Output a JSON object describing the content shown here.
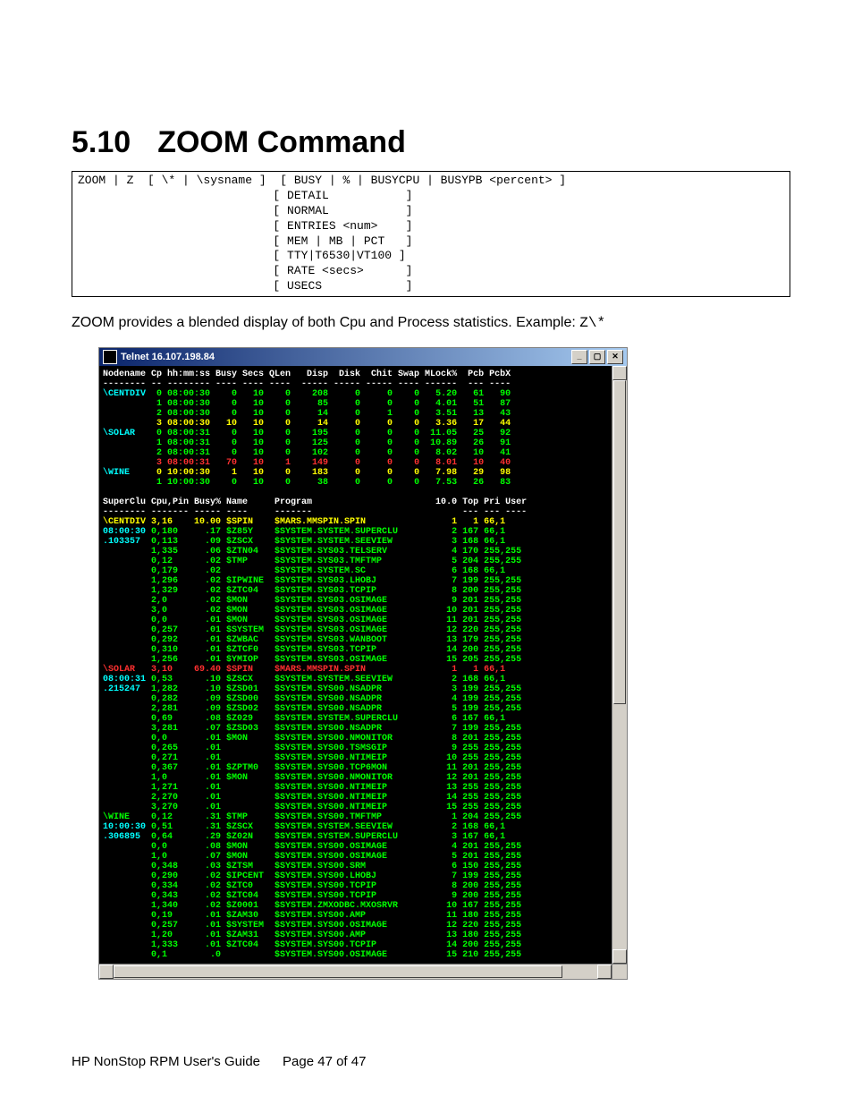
{
  "heading": {
    "number": "5.10",
    "title": "ZOOM Command"
  },
  "syntax_lines": [
    "ZOOM | Z  [ \\* | \\sysname ]  [ BUSY | % | BUSYCPU | BUSYPB <percent> ]",
    "                            [ DETAIL           ]",
    "                            [ NORMAL           ]",
    "                            [ ENTRIES <num>    ]",
    "                            [ MEM | MB | PCT   ]",
    "                            [ TTY|T6530|VT100 ]",
    "                            [ RATE <secs>      ]",
    "                            [ USECS            ]"
  ],
  "description": {
    "text": "ZOOM provides a blended display of both Cpu and Process statistics.    Example: ",
    "code": "Z\\*"
  },
  "telnet_title": "Telnet 16.107.198.84",
  "window_buttons": {
    "min": "_",
    "max": "▢",
    "close": "✕"
  },
  "term": {
    "header1": {
      "cols": "Nodename Cp hh:mm:ss Busy Secs QLen   Disp  Disk  Chit Swap MLock%  Pcb PcbX",
      "rule": "-------- -- -------- ---- ---- ----  ----- ----- ----- ---- ------  --- ----"
    },
    "top_section": {
      "nodes": [
        {
          "name": "\\CENTDIV",
          "name_color": "c-c",
          "rows": [
            {
              "color": "c-g",
              "cp": "0",
              "time": "08:00:30",
              "busy": "0",
              "secs": "10",
              "qlen": "0",
              "disp": "208",
              "disk": "0",
              "chit": "0",
              "swap": "0",
              "mlock": "5.20",
              "pcb": "61",
              "pcbx": "90"
            },
            {
              "color": "c-g",
              "cp": "1",
              "time": "08:00:30",
              "busy": "0",
              "secs": "10",
              "qlen": "0",
              "disp": "85",
              "disk": "0",
              "chit": "0",
              "swap": "0",
              "mlock": "4.01",
              "pcb": "51",
              "pcbx": "87"
            },
            {
              "color": "c-g",
              "cp": "2",
              "time": "08:00:30",
              "busy": "0",
              "secs": "10",
              "qlen": "0",
              "disp": "14",
              "disk": "0",
              "chit": "1",
              "swap": "0",
              "mlock": "3.51",
              "pcb": "13",
              "pcbx": "43"
            },
            {
              "color": "c-y",
              "cp": "3",
              "time": "08:00:30",
              "busy": "10",
              "secs": "10",
              "qlen": "0",
              "disp": "14",
              "disk": "0",
              "chit": "0",
              "swap": "0",
              "mlock": "3.36",
              "pcb": "17",
              "pcbx": "44"
            }
          ]
        },
        {
          "name": "\\SOLAR",
          "name_color": "c-c",
          "rows": [
            {
              "color": "c-g",
              "cp": "0",
              "time": "08:00:31",
              "busy": "0",
              "secs": "10",
              "qlen": "0",
              "disp": "195",
              "disk": "0",
              "chit": "0",
              "swap": "0",
              "mlock": "11.05",
              "pcb": "25",
              "pcbx": "92"
            },
            {
              "color": "c-g",
              "cp": "1",
              "time": "08:00:31",
              "busy": "0",
              "secs": "10",
              "qlen": "0",
              "disp": "125",
              "disk": "0",
              "chit": "0",
              "swap": "0",
              "mlock": "10.89",
              "pcb": "26",
              "pcbx": "91"
            },
            {
              "color": "c-g",
              "cp": "2",
              "time": "08:00:31",
              "busy": "0",
              "secs": "10",
              "qlen": "0",
              "disp": "102",
              "disk": "0",
              "chit": "0",
              "swap": "0",
              "mlock": "8.02",
              "pcb": "10",
              "pcbx": "41"
            },
            {
              "color": "c-r",
              "cp": "3",
              "time": "08:00:31",
              "busy": "70",
              "secs": "10",
              "qlen": "1",
              "disp": "149",
              "disk": "0",
              "chit": "0",
              "swap": "0",
              "mlock": "8.01",
              "pcb": "10",
              "pcbx": "40"
            }
          ]
        },
        {
          "name": "\\WINE",
          "name_color": "c-c",
          "rows": [
            {
              "color": "c-y",
              "cp": "0",
              "time": "10:00:30",
              "busy": "1",
              "secs": "10",
              "qlen": "0",
              "disp": "183",
              "disk": "0",
              "chit": "0",
              "swap": "0",
              "mlock": "7.98",
              "pcb": "29",
              "pcbx": "98"
            },
            {
              "color": "c-g",
              "cp": "1",
              "time": "10:00:30",
              "busy": "0",
              "secs": "10",
              "qlen": "0",
              "disp": "38",
              "disk": "0",
              "chit": "0",
              "swap": "0",
              "mlock": "7.53",
              "pcb": "26",
              "pcbx": "83"
            }
          ]
        }
      ]
    },
    "header2": {
      "cols": "SuperClu Cpu,Pin Busy% Name     Program                       10.0 Top Pri User",
      "rule": "-------- ------- ----- ----     -------                            --- --- ----"
    },
    "proc_section": {
      "groups": [
        {
          "head_color": "c-y",
          "head": [
            "\\CENTDIV",
            "3,16",
            "10.00",
            "$SPIN",
            "$MARS.MMSPIN.SPIN",
            "1",
            "1",
            "66,1"
          ],
          "time": "08:00:30",
          "frac": ".103357",
          "rows": [
            [
              "0,180",
              ".17",
              "$Z85Y",
              "$SYSTEM.SYSTEM.SUPERCLU",
              "2",
              "167",
              "66,1"
            ],
            [
              "0,113",
              ".09",
              "$ZSCX",
              "$SYSTEM.SYSTEM.SEEVIEW",
              "3",
              "168",
              "66,1"
            ],
            [
              "1,335",
              ".06",
              "$ZTN04",
              "$SYSTEM.SYS03.TELSERV",
              "4",
              "170",
              "255,255"
            ],
            [
              "0,12",
              ".02",
              "$TMP",
              "$SYSTEM.SYS03.TMFTMP",
              "5",
              "204",
              "255,255"
            ],
            [
              "0,179",
              ".02",
              "",
              "$SYSTEM.SYSTEM.SC",
              "6",
              "168",
              "66,1"
            ],
            [
              "1,296",
              ".02",
              "$IPWINE",
              "$SYSTEM.SYS03.LHOBJ",
              "7",
              "199",
              "255,255"
            ],
            [
              "1,329",
              ".02",
              "$ZTC04",
              "$SYSTEM.SYS03.TCPIP",
              "8",
              "200",
              "255,255"
            ],
            [
              "2,0",
              ".02",
              "$MON",
              "$SYSTEM.SYS03.OSIMAGE",
              "9",
              "201",
              "255,255"
            ],
            [
              "3,0",
              ".02",
              "$MON",
              "$SYSTEM.SYS03.OSIMAGE",
              "10",
              "201",
              "255,255"
            ],
            [
              "0,0",
              ".01",
              "$MON",
              "$SYSTEM.SYS03.OSIMAGE",
              "11",
              "201",
              "255,255"
            ],
            [
              "0,257",
              ".01",
              "$SYSTEM",
              "$SYSTEM.SYS03.OSIMAGE",
              "12",
              "220",
              "255,255"
            ],
            [
              "0,292",
              ".01",
              "$ZWBAC",
              "$SYSTEM.SYS03.WANBOOT",
              "13",
              "179",
              "255,255"
            ],
            [
              "0,310",
              ".01",
              "$ZTCF0",
              "$SYSTEM.SYS03.TCPIP",
              "14",
              "200",
              "255,255"
            ],
            [
              "1,256",
              ".01",
              "$YMIOP",
              "$SYSTEM.SYS03.OSIMAGE",
              "15",
              "205",
              "255,255"
            ]
          ]
        },
        {
          "head_color": "c-r",
          "head": [
            "\\SOLAR",
            "3,10",
            "69.40",
            "$SPIN",
            "$MARS.MMSPIN.SPIN",
            "1",
            "1",
            "66,1"
          ],
          "time": "08:00:31",
          "frac": ".215247",
          "rows": [
            [
              "0,53",
              ".10",
              "$ZSCX",
              "$SYSTEM.SYSTEM.SEEVIEW",
              "2",
              "168",
              "66,1"
            ],
            [
              "1,282",
              ".10",
              "$ZSD01",
              "$SYSTEM.SYS00.NSADPR",
              "3",
              "199",
              "255,255"
            ],
            [
              "0,282",
              ".09",
              "$ZSD00",
              "$SYSTEM.SYS00.NSADPR",
              "4",
              "199",
              "255,255"
            ],
            [
              "2,281",
              ".09",
              "$ZSD02",
              "$SYSTEM.SYS00.NSADPR",
              "5",
              "199",
              "255,255"
            ],
            [
              "0,69",
              ".08",
              "$Z029",
              "$SYSTEM.SYSTEM.SUPERCLU",
              "6",
              "167",
              "66,1"
            ],
            [
              "3,281",
              ".07",
              "$ZSD03",
              "$SYSTEM.SYS00.NSADPR",
              "7",
              "199",
              "255,255"
            ],
            [
              "0,0",
              ".01",
              "$MON",
              "$SYSTEM.SYS00.NMONITOR",
              "8",
              "201",
              "255,255"
            ],
            [
              "0,265",
              ".01",
              "",
              "$SYSTEM.SYS00.TSMSGIP",
              "9",
              "255",
              "255,255"
            ],
            [
              "0,271",
              ".01",
              "",
              "$SYSTEM.SYS00.NTIMEIP",
              "10",
              "255",
              "255,255"
            ],
            [
              "0,367",
              ".01",
              "$ZPTM0",
              "$SYSTEM.SYS00.TCP6MON",
              "11",
              "201",
              "255,255"
            ],
            [
              "1,0",
              ".01",
              "$MON",
              "$SYSTEM.SYS00.NMONITOR",
              "12",
              "201",
              "255,255"
            ],
            [
              "1,271",
              ".01",
              "",
              "$SYSTEM.SYS00.NTIMEIP",
              "13",
              "255",
              "255,255"
            ],
            [
              "2,270",
              ".01",
              "",
              "$SYSTEM.SYS00.NTIMEIP",
              "14",
              "255",
              "255,255"
            ],
            [
              "3,270",
              ".01",
              "",
              "$SYSTEM.SYS00.NTIMEIP",
              "15",
              "255",
              "255,255"
            ]
          ]
        },
        {
          "head_color": "c-g",
          "head": [
            "\\WINE",
            "0,12",
            ".31",
            "$TMP",
            "$SYSTEM.SYS00.TMFTMP",
            "1",
            "204",
            "255,255"
          ],
          "time": "10:00:30",
          "frac": ".306895",
          "rows": [
            [
              "0,51",
              ".31",
              "$ZSCX",
              "$SYSTEM.SYSTEM.SEEVIEW",
              "2",
              "168",
              "66,1"
            ],
            [
              "0,64",
              ".29",
              "$Z02N",
              "$SYSTEM.SYSTEM.SUPERCLU",
              "3",
              "167",
              "66,1"
            ],
            [
              "0,0",
              ".08",
              "$MON",
              "$SYSTEM.SYS00.OSIMAGE",
              "4",
              "201",
              "255,255"
            ],
            [
              "1,0",
              ".07",
              "$MON",
              "$SYSTEM.SYS00.OSIMAGE",
              "5",
              "201",
              "255,255"
            ],
            [
              "0,348",
              ".03",
              "$ZTSM",
              "$SYSTEM.SYS00.SRM",
              "6",
              "150",
              "255,255"
            ],
            [
              "0,290",
              ".02",
              "$IPCENT",
              "$SYSTEM.SYS00.LHOBJ",
              "7",
              "199",
              "255,255"
            ],
            [
              "0,334",
              ".02",
              "$ZTC0",
              "$SYSTEM.SYS00.TCPIP",
              "8",
              "200",
              "255,255"
            ],
            [
              "0,343",
              ".02",
              "$ZTC04",
              "$SYSTEM.SYS00.TCPIP",
              "9",
              "200",
              "255,255"
            ],
            [
              "1,340",
              ".02",
              "$Z0001",
              "$SYSTEM.ZMXODBC.MXOSRVR",
              "10",
              "167",
              "255,255"
            ],
            [
              "0,19",
              ".01",
              "$ZAM30",
              "$SYSTEM.SYS00.AMP",
              "11",
              "180",
              "255,255"
            ],
            [
              "0,257",
              ".01",
              "$SYSTEM",
              "$SYSTEM.SYS00.OSIMAGE",
              "12",
              "220",
              "255,255"
            ],
            [
              "1,20",
              ".01",
              "$ZAM31",
              "$SYSTEM.SYS00.AMP",
              "13",
              "180",
              "255,255"
            ],
            [
              "1,333",
              ".01",
              "$ZTC04",
              "$SYSTEM.SYS00.TCPIP",
              "14",
              "200",
              "255,255"
            ],
            [
              "0,1",
              ".0",
              "",
              "$SYSTEM.SYS00.OSIMAGE",
              "15",
              "210",
              "255,255"
            ]
          ]
        }
      ]
    }
  },
  "footer": {
    "left": "HP NonStop RPM User's Guide",
    "right": "Page 47 of 47"
  }
}
